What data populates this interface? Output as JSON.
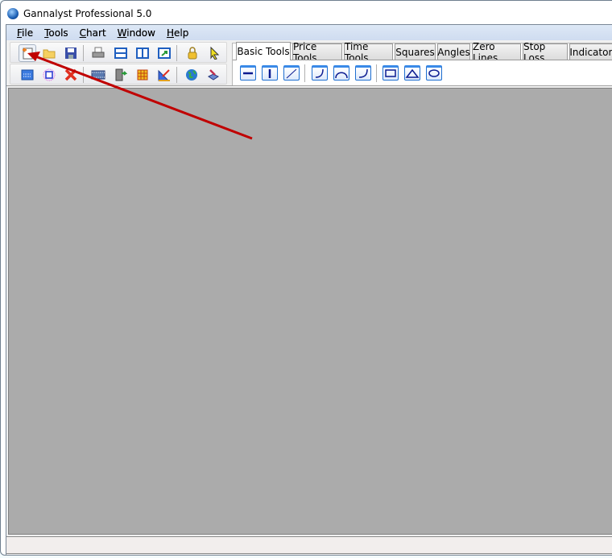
{
  "window": {
    "title": "Gannalyst Professional 5.0"
  },
  "menu": [
    {
      "label": "File",
      "key": "F",
      "rest": "ile"
    },
    {
      "label": "Tools",
      "key": "T",
      "rest": "ools"
    },
    {
      "label": "Chart",
      "key": "C",
      "rest": "hart"
    },
    {
      "label": "Window",
      "key": "W",
      "rest": "indow"
    },
    {
      "label": "Help",
      "key": "H",
      "rest": "elp"
    }
  ],
  "tabs": {
    "items": [
      "Basic Tools",
      "Price Tools",
      "Time Tools",
      "Squares",
      "Angles",
      "Zero Lines",
      "Stop Loss",
      "Indicators"
    ],
    "active": "Basic Tools"
  },
  "colors": {
    "annotation_arrow": "#c00000",
    "canvas": "#ababab",
    "tool_border": "#1f6fd0"
  }
}
